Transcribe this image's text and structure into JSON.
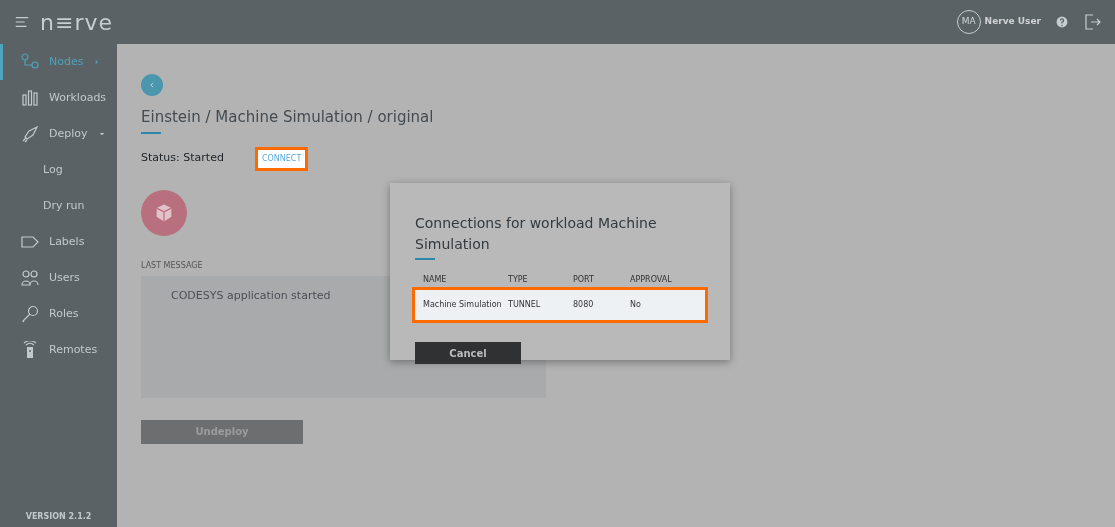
{
  "topbar": {
    "logo": "n≡rve",
    "user_initials": "MA",
    "user_name": "Nerve User"
  },
  "sidebar": {
    "items": [
      {
        "kind": "nodes",
        "label": "Nodes",
        "selected": true,
        "expanded": false
      },
      {
        "kind": "workloads",
        "label": "Workloads",
        "selected": false
      },
      {
        "kind": "deploy",
        "label": "Deploy",
        "selected": false,
        "expanded": true,
        "children": [
          {
            "label": "Log",
            "selected": false
          },
          {
            "label": "Dry run",
            "selected": false
          }
        ]
      },
      {
        "kind": "labels",
        "label": "Labels",
        "selected": false
      },
      {
        "kind": "users",
        "label": "Users",
        "selected": false
      },
      {
        "kind": "roles",
        "label": "Roles",
        "selected": false
      },
      {
        "kind": "remotes",
        "label": "Remotes",
        "selected": false
      }
    ],
    "version": "VERSION 2.1.2"
  },
  "page": {
    "title": "Einstein / Machine Simulation / original",
    "status": "Status: Started",
    "connect": {
      "label": "CONNECT",
      "highlighted": true
    },
    "last_message_label": "LAST MESSAGE",
    "last_message": "CODESYS application started",
    "undeploy": "Undeploy"
  },
  "modal": {
    "title": "Connections for workload Machine Simulation",
    "columns": [
      "NAME",
      "TYPE",
      "PORT",
      "APPROVAL"
    ],
    "rows": [
      {
        "cells": [
          "Machine Simulation",
          "TUNNEL",
          "8080",
          "No"
        ],
        "highlighted": true
      }
    ],
    "cancel": "Cancel"
  }
}
